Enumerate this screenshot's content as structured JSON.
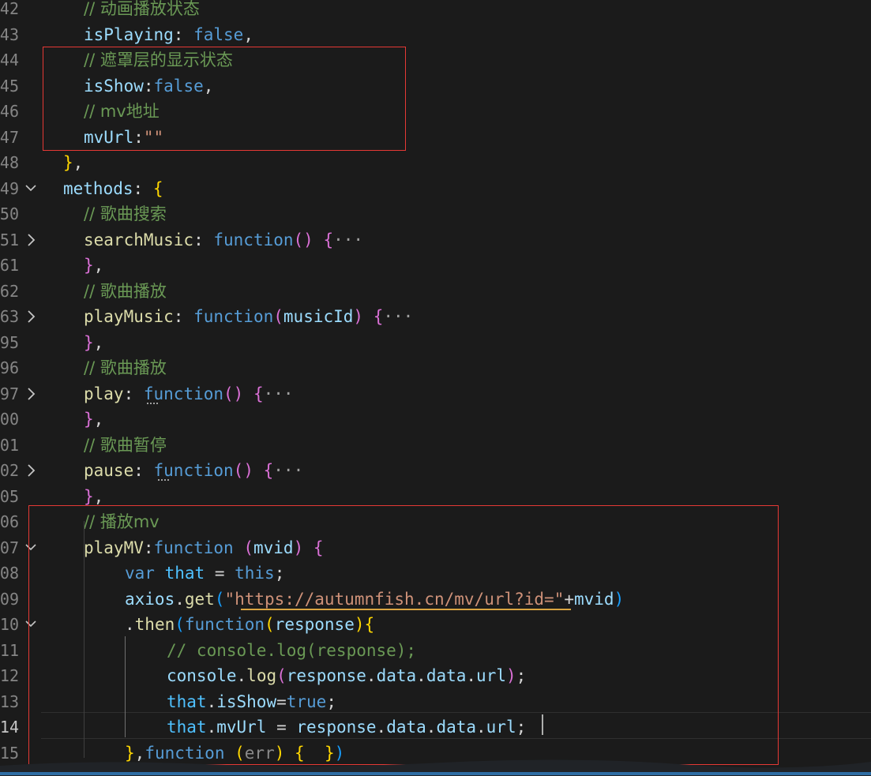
{
  "editor": {
    "lines": [
      {
        "number": "42",
        "fold": "",
        "indent": 106,
        "tokens": [
          {
            "t": "// 动画播放状态",
            "c": "comment"
          }
        ]
      },
      {
        "number": "43",
        "fold": "",
        "indent": 106,
        "tokens": [
          {
            "t": "isPlaying",
            "c": "prop"
          },
          {
            "t": ": ",
            "c": "punc"
          },
          {
            "t": "false",
            "c": "kw"
          },
          {
            "t": ",",
            "c": "punc"
          }
        ]
      },
      {
        "number": "44",
        "fold": "",
        "indent": 106,
        "tokens": [
          {
            "t": "// 遮罩层的显示状态",
            "c": "comment"
          }
        ]
      },
      {
        "number": "45",
        "fold": "",
        "indent": 106,
        "tokens": [
          {
            "t": "isShow",
            "c": "prop"
          },
          {
            "t": ":",
            "c": "punc"
          },
          {
            "t": "false",
            "c": "kw"
          },
          {
            "t": ",",
            "c": "punc"
          }
        ]
      },
      {
        "number": "46",
        "fold": "",
        "indent": 106,
        "tokens": [
          {
            "t": "// mv地址",
            "c": "comment"
          }
        ]
      },
      {
        "number": "47",
        "fold": "",
        "indent": 106,
        "tokens": [
          {
            "t": "mvUrl",
            "c": "prop"
          },
          {
            "t": ":",
            "c": "punc"
          },
          {
            "t": "\"\"",
            "c": "str"
          }
        ]
      },
      {
        "number": "48",
        "fold": "",
        "indent": 80,
        "tokens": [
          {
            "t": "}",
            "c": "brace"
          },
          {
            "t": ",",
            "c": "punc"
          }
        ]
      },
      {
        "number": "49",
        "fold": "expanded",
        "indent": 80,
        "tokens": [
          {
            "t": "methods",
            "c": "prop"
          },
          {
            "t": ": ",
            "c": "punc"
          },
          {
            "t": "{",
            "c": "brace"
          }
        ]
      },
      {
        "number": "50",
        "fold": "",
        "indent": 106,
        "tokens": [
          {
            "t": "// 歌曲搜索",
            "c": "comment"
          }
        ]
      },
      {
        "number": "51",
        "fold": "collapsed",
        "indent": 106,
        "tokens": [
          {
            "t": "searchMusic",
            "c": "meth"
          },
          {
            "t": ": ",
            "c": "punc"
          },
          {
            "t": "function",
            "c": "kw"
          },
          {
            "t": "()",
            "c": "paren"
          },
          {
            "t": " ",
            "c": "punc"
          },
          {
            "t": "{",
            "c": "paren"
          },
          {
            "t": "···",
            "c": "ellip"
          }
        ]
      },
      {
        "number": "61",
        "fold": "",
        "indent": 106,
        "tokens": [
          {
            "t": "}",
            "c": "paren"
          },
          {
            "t": ",",
            "c": "punc"
          }
        ]
      },
      {
        "number": "62",
        "fold": "",
        "indent": 106,
        "tokens": [
          {
            "t": "// 歌曲播放",
            "c": "comment"
          }
        ]
      },
      {
        "number": "63",
        "fold": "collapsed",
        "indent": 106,
        "tokens": [
          {
            "t": "playMusic",
            "c": "meth"
          },
          {
            "t": ": ",
            "c": "punc"
          },
          {
            "t": "function",
            "c": "kw"
          },
          {
            "t": "(",
            "c": "paren"
          },
          {
            "t": "musicId",
            "c": "prop"
          },
          {
            "t": ")",
            "c": "paren"
          },
          {
            "t": " ",
            "c": "punc"
          },
          {
            "t": "{",
            "c": "paren"
          },
          {
            "t": "···",
            "c": "ellip"
          }
        ]
      },
      {
        "number": "95",
        "fold": "",
        "indent": 106,
        "tokens": [
          {
            "t": "}",
            "c": "paren"
          },
          {
            "t": ",",
            "c": "punc"
          }
        ]
      },
      {
        "number": "96",
        "fold": "",
        "indent": 106,
        "tokens": [
          {
            "t": "// 歌曲播放",
            "c": "comment"
          }
        ]
      },
      {
        "number": "97",
        "fold": "collapsed",
        "indent": 106,
        "tokens": [
          {
            "t": "play",
            "c": "meth"
          },
          {
            "t": ": ",
            "c": "punc"
          },
          {
            "t": "function",
            "c": "kw"
          },
          {
            "t": "()",
            "c": "paren"
          },
          {
            "t": " ",
            "c": "punc"
          },
          {
            "t": "{",
            "c": "paren"
          },
          {
            "t": "···",
            "c": "ellip"
          }
        ]
      },
      {
        "number": "00",
        "fold": "",
        "indent": 106,
        "tokens": [
          {
            "t": "}",
            "c": "paren"
          },
          {
            "t": ",",
            "c": "punc"
          }
        ]
      },
      {
        "number": "01",
        "fold": "",
        "indent": 106,
        "tokens": [
          {
            "t": "// 歌曲暂停",
            "c": "comment"
          }
        ]
      },
      {
        "number": "02",
        "fold": "collapsed",
        "indent": 106,
        "tokens": [
          {
            "t": "pause",
            "c": "meth"
          },
          {
            "t": ": ",
            "c": "punc"
          },
          {
            "t": "function",
            "c": "kw"
          },
          {
            "t": "()",
            "c": "paren"
          },
          {
            "t": " ",
            "c": "punc"
          },
          {
            "t": "{",
            "c": "paren"
          },
          {
            "t": "···",
            "c": "ellip"
          }
        ]
      },
      {
        "number": "05",
        "fold": "",
        "indent": 106,
        "tokens": [
          {
            "t": "}",
            "c": "paren"
          },
          {
            "t": ",",
            "c": "punc"
          }
        ]
      },
      {
        "number": "06",
        "fold": "",
        "indent": 106,
        "tokens": [
          {
            "t": "// 播放mv",
            "c": "comment"
          }
        ]
      },
      {
        "number": "07",
        "fold": "expanded",
        "indent": 106,
        "tokens": [
          {
            "t": "playMV",
            "c": "meth"
          },
          {
            "t": ":",
            "c": "punc"
          },
          {
            "t": "function",
            "c": "kw"
          },
          {
            "t": " ",
            "c": "punc"
          },
          {
            "t": "(",
            "c": "paren"
          },
          {
            "t": "mvid",
            "c": "prop"
          },
          {
            "t": ")",
            "c": "paren"
          },
          {
            "t": " ",
            "c": "punc"
          },
          {
            "t": "{",
            "c": "paren"
          }
        ]
      },
      {
        "number": "08",
        "fold": "",
        "indent": 158,
        "tokens": [
          {
            "t": "var",
            "c": "kw"
          },
          {
            "t": " ",
            "c": "punc"
          },
          {
            "t": "that",
            "c": "kw2"
          },
          {
            "t": " = ",
            "c": "punc"
          },
          {
            "t": "this",
            "c": "kw"
          },
          {
            "t": ";",
            "c": "punc"
          }
        ]
      },
      {
        "number": "09",
        "fold": "",
        "indent": 158,
        "tokens": [
          {
            "t": "axios",
            "c": "prop"
          },
          {
            "t": ".",
            "c": "punc"
          },
          {
            "t": "get",
            "c": "meth"
          },
          {
            "t": "(",
            "c": "paren2"
          },
          {
            "t": "\"https://autumnfish.cn/mv/url?id=\"",
            "c": "str"
          },
          {
            "t": "+",
            "c": "punc"
          },
          {
            "t": "mvid",
            "c": "prop"
          },
          {
            "t": ")",
            "c": "paren2"
          }
        ]
      },
      {
        "number": "10",
        "fold": "expanded",
        "indent": 158,
        "tokens": [
          {
            "t": ".",
            "c": "punc"
          },
          {
            "t": "then",
            "c": "meth"
          },
          {
            "t": "(",
            "c": "paren2"
          },
          {
            "t": "function",
            "c": "kw"
          },
          {
            "t": "(",
            "c": "brace"
          },
          {
            "t": "response",
            "c": "prop"
          },
          {
            "t": ")",
            "c": "brace"
          },
          {
            "t": "{",
            "c": "brace"
          }
        ]
      },
      {
        "number": "11",
        "fold": "",
        "indent": 211,
        "tokens": [
          {
            "t": "// console.log(response);",
            "c": "comment"
          }
        ]
      },
      {
        "number": "12",
        "fold": "",
        "indent": 211,
        "tokens": [
          {
            "t": "console",
            "c": "prop"
          },
          {
            "t": ".",
            "c": "punc"
          },
          {
            "t": "log",
            "c": "meth"
          },
          {
            "t": "(",
            "c": "paren"
          },
          {
            "t": "response",
            "c": "prop"
          },
          {
            "t": ".",
            "c": "punc"
          },
          {
            "t": "data",
            "c": "prop"
          },
          {
            "t": ".",
            "c": "punc"
          },
          {
            "t": "data",
            "c": "prop"
          },
          {
            "t": ".",
            "c": "punc"
          },
          {
            "t": "url",
            "c": "prop"
          },
          {
            "t": ")",
            "c": "paren"
          },
          {
            "t": ";",
            "c": "punc"
          }
        ]
      },
      {
        "number": "13",
        "fold": "",
        "indent": 211,
        "tokens": [
          {
            "t": "that",
            "c": "kw2"
          },
          {
            "t": ".",
            "c": "punc"
          },
          {
            "t": "isShow",
            "c": "prop"
          },
          {
            "t": "=",
            "c": "punc"
          },
          {
            "t": "true",
            "c": "kw"
          },
          {
            "t": ";",
            "c": "punc"
          }
        ]
      },
      {
        "number": "14",
        "fold": "",
        "indent": 211,
        "tokens": [
          {
            "t": "that",
            "c": "kw2"
          },
          {
            "t": ".",
            "c": "punc"
          },
          {
            "t": "mvUrl",
            "c": "prop"
          },
          {
            "t": " = ",
            "c": "punc"
          },
          {
            "t": "response",
            "c": "prop"
          },
          {
            "t": ".",
            "c": "punc"
          },
          {
            "t": "data",
            "c": "prop"
          },
          {
            "t": ".",
            "c": "punc"
          },
          {
            "t": "data",
            "c": "prop"
          },
          {
            "t": ".",
            "c": "punc"
          },
          {
            "t": "url",
            "c": "prop"
          },
          {
            "t": ";",
            "c": "punc"
          }
        ]
      },
      {
        "number": "15",
        "fold": "",
        "indent": 158,
        "tokens": [
          {
            "t": "}",
            "c": "brace"
          },
          {
            "t": ",",
            "c": "punc"
          },
          {
            "t": "function",
            "c": "kw"
          },
          {
            "t": " ",
            "c": "punc"
          },
          {
            "t": "(",
            "c": "brace"
          },
          {
            "t": "err",
            "c": "err"
          },
          {
            "t": ")",
            "c": "brace"
          },
          {
            "t": " ",
            "c": "punc"
          },
          {
            "t": "{",
            "c": "brace"
          },
          {
            "t": "  ",
            "c": "punc"
          },
          {
            "t": "}",
            "c": "brace"
          },
          {
            "t": ")",
            "c": "paren2"
          }
        ]
      }
    ]
  },
  "theme": {
    "background": "#1b1b1b",
    "highlight_box_color": "#e53935",
    "comment": "#6a9955",
    "keyword": "#569cd6",
    "property": "#9cdcfe",
    "method": "#dcdcaa",
    "string": "#ce9178"
  }
}
